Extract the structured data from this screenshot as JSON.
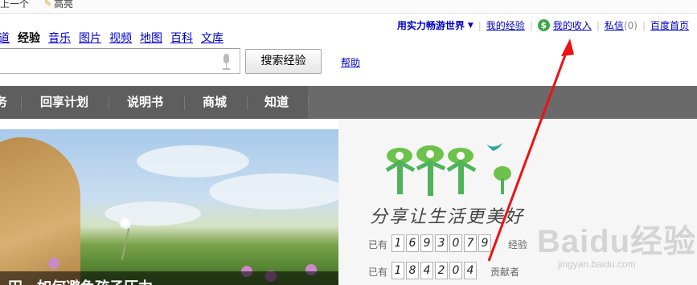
{
  "topbar": {
    "prev_label": "上一个",
    "highlight_label": "高亮"
  },
  "userbar": {
    "username": "用实力畅游世界",
    "my_exp": "我的经验",
    "my_income": "我的收入",
    "messages": "私信",
    "messages_count": "(0)",
    "baidu_home": "百度首页"
  },
  "nav": {
    "items": [
      {
        "label": "道",
        "current": false
      },
      {
        "label": "经验",
        "current": true
      },
      {
        "label": "音乐",
        "current": false
      },
      {
        "label": "图片",
        "current": false
      },
      {
        "label": "视频",
        "current": false
      },
      {
        "label": "地图",
        "current": false
      },
      {
        "label": "百科",
        "current": false
      },
      {
        "label": "文库",
        "current": false
      }
    ]
  },
  "search": {
    "value": "",
    "button_label": "搜索经验",
    "help_label": "帮助"
  },
  "category_bar": {
    "items": [
      "务",
      "回享计划",
      "说明书",
      "商城",
      "知道"
    ]
  },
  "hero": {
    "caption": "田，如何避免孩子压力"
  },
  "promo": {
    "slogan": "分享让生活更美好",
    "row1": {
      "prefix": "已有",
      "digits": [
        "1",
        "6",
        "9",
        "3",
        "0",
        "7",
        "9"
      ],
      "suffix": "经验"
    },
    "row2": {
      "prefix": "已有",
      "digits": [
        "1",
        "8",
        "4",
        "2",
        "0",
        "4"
      ],
      "suffix": "贡献者"
    }
  },
  "watermark": {
    "text": "Baidu经验",
    "sub": "jingyan.baidu.com"
  },
  "colors": {
    "link": "#0000cc",
    "category_bar": "#5e5e5e",
    "logo_green": "#6cc24a",
    "logo_teal": "#2fa8a0",
    "arrow_red": "#ee1111",
    "income_coin": "#3aa847"
  }
}
